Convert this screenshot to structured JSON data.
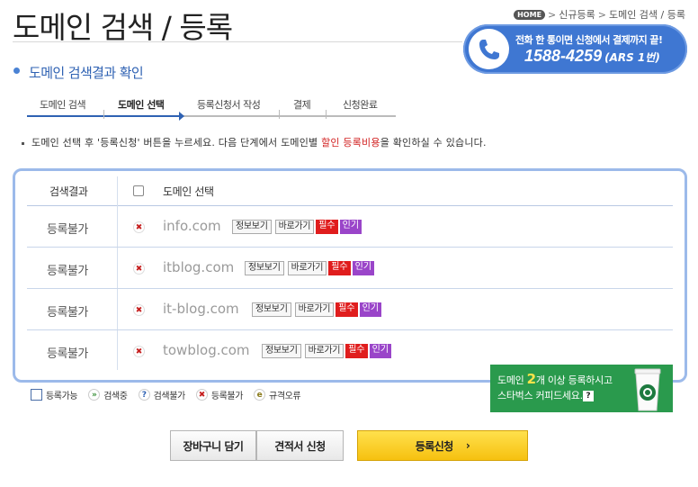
{
  "page": {
    "title": "도메인 검색 / 등록"
  },
  "breadcrumb": {
    "home": "HOME",
    "sep": ">",
    "items": [
      "신규등록",
      "도메인 검색 / 등록"
    ]
  },
  "phone_banner": {
    "line1": "전화 한 통이면 신청에서 결제까지 끝!",
    "number": "1588-4259",
    "ars": "(ARS 1번)"
  },
  "section": {
    "heading": "도메인 검색결과 확인"
  },
  "steps": [
    {
      "label": "도메인 검색"
    },
    {
      "label": "도메인 선택"
    },
    {
      "label": "등록신청서 작성"
    },
    {
      "label": "결제"
    },
    {
      "label": "신청완료"
    }
  ],
  "instruction": {
    "part1": "도메인 선택 후 '등록신청' 버튼을 누르세요. 다음 단계에서 도메인별 ",
    "highlight": "할인 등록비용",
    "part2": "을 확인하실 수 있습니다."
  },
  "table": {
    "col_status": "검색결과",
    "col_domain": "도메인 선택",
    "button_info": "정보보기",
    "button_goto": "바로가기",
    "badge_required": "필수",
    "badge_popular": "인기",
    "rows": [
      {
        "status": "등록불가",
        "domain": "info.com"
      },
      {
        "status": "등록불가",
        "domain": "itblog.com"
      },
      {
        "status": "등록불가",
        "domain": "it-blog.com"
      },
      {
        "status": "등록불가",
        "domain": "towblog.com"
      }
    ]
  },
  "promo": {
    "line1_a": "도메인 ",
    "line1_num": "2",
    "line1_b": "개 이상 등록하시고",
    "line2": "스타벅스 커피드세요.",
    "qmark": "?"
  },
  "legend": {
    "items": [
      {
        "icon": "",
        "label": "등록가능"
      },
      {
        "icon": "»",
        "label": "검색중"
      },
      {
        "icon": "?",
        "label": "검색불가"
      },
      {
        "icon": "✖",
        "label": "등록불가"
      },
      {
        "icon": "e",
        "label": "규격오류"
      }
    ]
  },
  "actions": {
    "cart": "장바구니 담기",
    "quote": "견적서 신청",
    "register": "등록신청",
    "register_arrow": "›"
  },
  "colors": {
    "accent_blue": "#2f62b3",
    "banner_blue": "#3f77d2",
    "panel_border": "#9cbaea",
    "required_red": "#e01d1d",
    "popular_purple": "#9a45c9",
    "promo_green": "#2a9a4d",
    "register_yellow": "#f6c10f"
  }
}
